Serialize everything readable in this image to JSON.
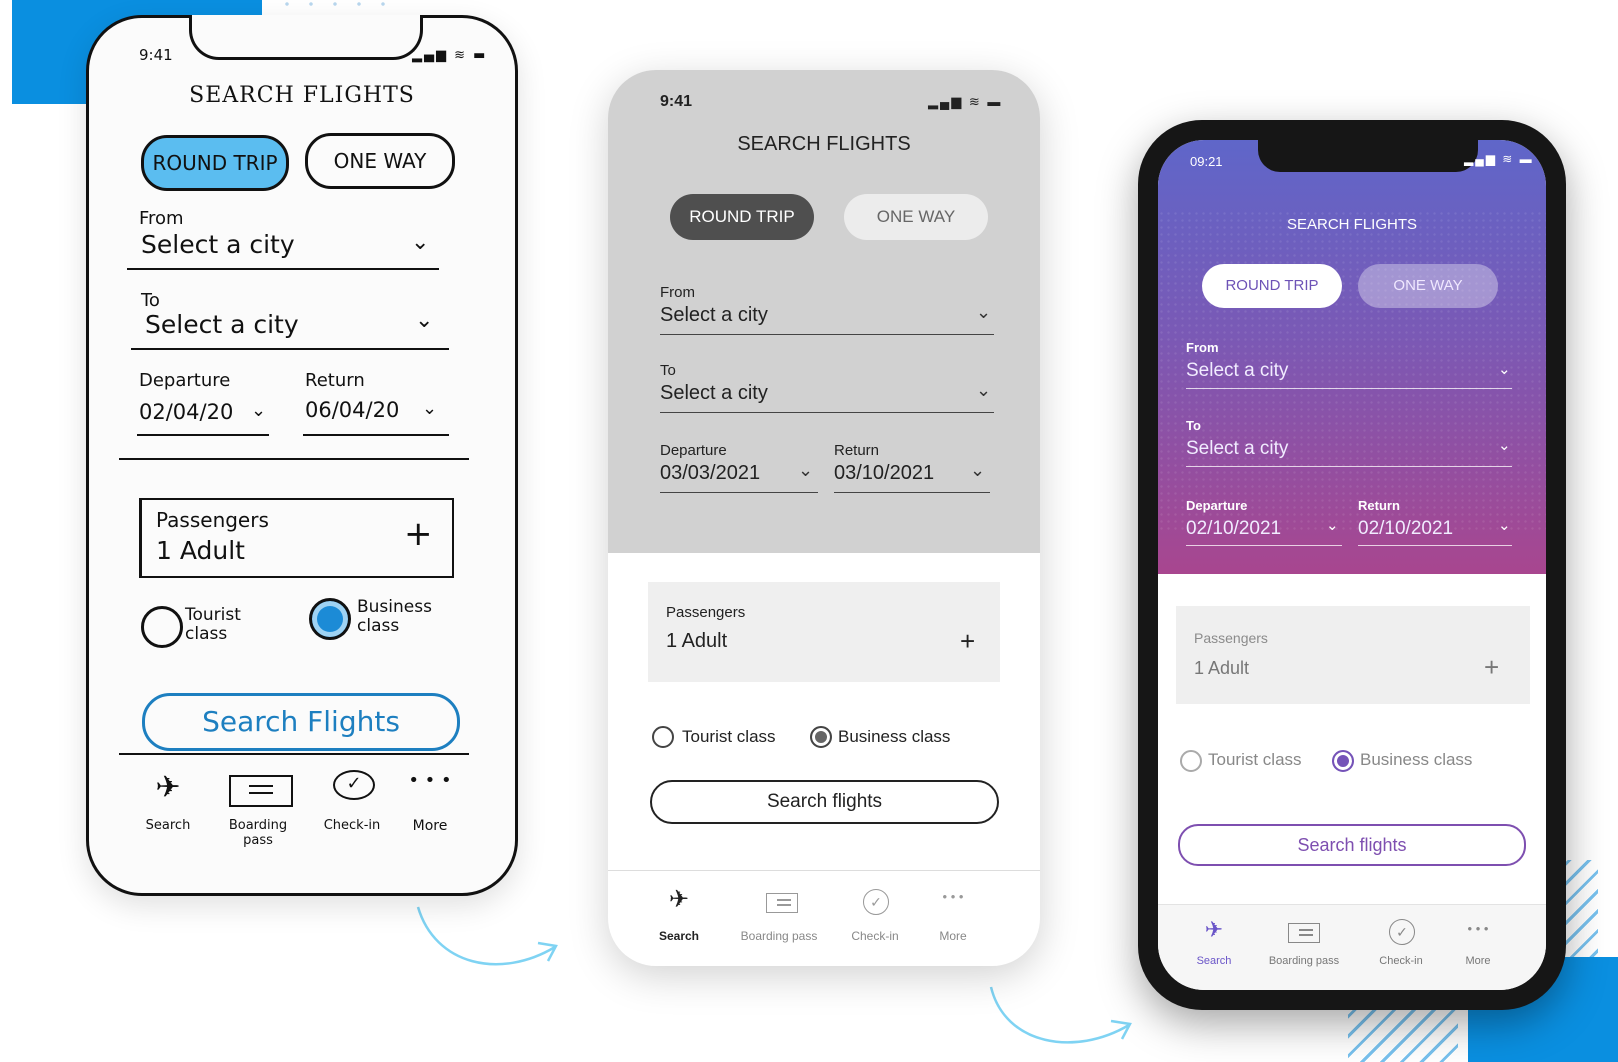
{
  "sketch": {
    "time": "9:41",
    "status": "▂▄▆ ≋ ▬",
    "title": "SEARCH FLIGHTS",
    "trip_round": "ROUND TRIP",
    "trip_one": "ONE WAY",
    "from_label": "From",
    "from_value": "Select a city",
    "to_label": "To",
    "to_value": "Select a city",
    "departure_label": "Departure",
    "departure_value": "02/04/20",
    "return_label": "Return",
    "return_value": "06/04/20",
    "passengers_label": "Passengers",
    "passengers_value": "1 Adult",
    "tourist_label": "Tourist class",
    "business_label": "Business class",
    "search_button": "Search Flights",
    "nav": [
      "Search",
      "Boarding pass",
      "Check-in",
      "More"
    ]
  },
  "wireframe": {
    "time": "9:41",
    "status": "▂▄▆ ≋ ▬",
    "title": "SEARCH FLIGHTS",
    "trip_round": "ROUND TRIP",
    "trip_one": "ONE WAY",
    "from_label": "From",
    "from_value": "Select a city",
    "to_label": "To",
    "to_value": "Select a city",
    "departure_label": "Departure",
    "departure_value": "03/03/2021",
    "return_label": "Return",
    "return_value": "03/10/2021",
    "passengers_label": "Passengers",
    "passengers_value": "1 Adult",
    "tourist_label": "Tourist class",
    "business_label": "Business class",
    "search_button": "Search flights",
    "nav": [
      "Search",
      "Boarding pass",
      "Check-in",
      "More"
    ]
  },
  "final": {
    "time": "09:21",
    "status": "▂▄▆ ≋ ▬",
    "title": "SEARCH FLIGHTS",
    "trip_round": "ROUND TRIP",
    "trip_one": "ONE WAY",
    "from_label": "From",
    "from_value": "Select a city",
    "to_label": "To",
    "to_value": "Select a city",
    "departure_label": "Departure",
    "departure_value": "02/10/2021",
    "return_label": "Return",
    "return_value": "02/10/2021",
    "passengers_label": "Passengers",
    "passengers_value": "1 Adult",
    "tourist_label": "Tourist class",
    "business_label": "Business class",
    "search_button": "Search flights",
    "nav": [
      "Search",
      "Boarding pass",
      "Check-in",
      "More"
    ]
  },
  "icons": {
    "chevron": "⌄",
    "plus": "+",
    "plane": "✈",
    "more": "• • •"
  },
  "colors": {
    "accent_blue": "#0a8fe0",
    "gradient_top": "#5f66c9",
    "gradient_bottom": "#a8468f",
    "final_accent": "#7553b8"
  }
}
